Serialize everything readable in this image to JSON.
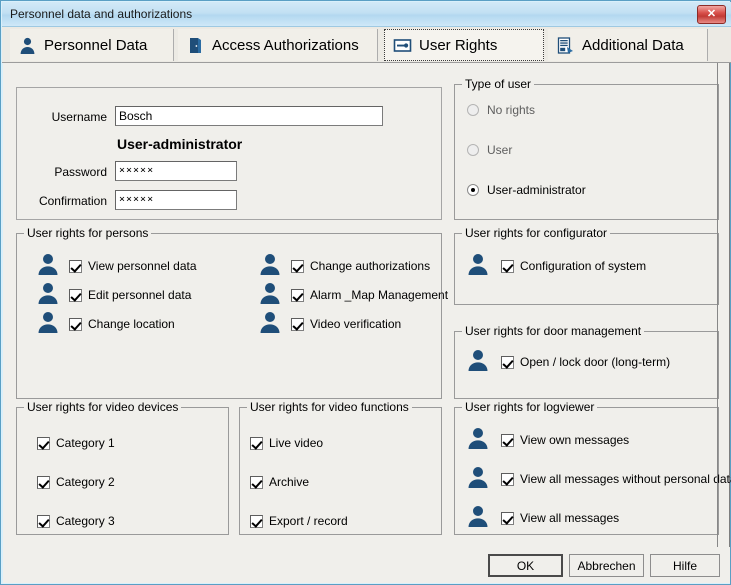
{
  "window": {
    "title": "Personnel data and authorizations",
    "close_label": "✕"
  },
  "tabs": [
    {
      "label": "Personnel Data",
      "icon": "person-icon",
      "active": false
    },
    {
      "label": "Access Authorizations",
      "icon": "door-icon",
      "active": false
    },
    {
      "label": "User Rights",
      "icon": "key-icon",
      "active": true
    },
    {
      "label": "Additional Data",
      "icon": "document-icon",
      "active": false
    }
  ],
  "credentials": {
    "username_label": "Username",
    "username_value": "Bosch",
    "role_heading": "User-administrator",
    "password_label": "Password",
    "password_value": "×××××",
    "confirmation_label": "Confirmation",
    "confirmation_value": "×××××"
  },
  "type_of_user": {
    "title": "Type of user",
    "options": [
      {
        "label": "No rights",
        "selected": false,
        "disabled": true
      },
      {
        "label": "User",
        "selected": false,
        "disabled": true
      },
      {
        "label": "User-administrator",
        "selected": true,
        "disabled": false
      }
    ]
  },
  "rights_persons": {
    "title": "User rights for persons",
    "left": [
      {
        "label": "View personnel data",
        "checked": true
      },
      {
        "label": "Edit personnel data",
        "checked": true
      },
      {
        "label": "Change location",
        "checked": true
      }
    ],
    "right": [
      {
        "label": "Change authorizations",
        "checked": true
      },
      {
        "label": "Alarm _Map Management",
        "checked": true
      },
      {
        "label": "Video verification",
        "checked": true
      }
    ]
  },
  "rights_configurator": {
    "title": "User rights for configurator",
    "items": [
      {
        "label": "Configuration of system",
        "checked": true
      }
    ]
  },
  "rights_door": {
    "title": "User rights for door management",
    "items": [
      {
        "label": "Open / lock door (long-term)",
        "checked": true
      }
    ]
  },
  "rights_video_devices": {
    "title": "User rights for video devices",
    "items": [
      {
        "label": "Category 1",
        "checked": true
      },
      {
        "label": "Category 2",
        "checked": true
      },
      {
        "label": "Category 3",
        "checked": true
      }
    ]
  },
  "rights_video_functions": {
    "title": "User rights for video functions",
    "items": [
      {
        "label": "Live video",
        "checked": true
      },
      {
        "label": "Archive",
        "checked": true
      },
      {
        "label": "Export / record",
        "checked": true
      }
    ]
  },
  "rights_logviewer": {
    "title": "User rights for logviewer",
    "items": [
      {
        "label": "View own messages",
        "checked": true
      },
      {
        "label": "View all messages without personal data",
        "checked": true
      },
      {
        "label": "View all messages",
        "checked": true
      }
    ]
  },
  "buttons": {
    "ok": "OK",
    "cancel": "Abbrechen",
    "help": "Hilfe"
  },
  "colors": {
    "titlebar": "#c2e0f3",
    "close_red": "#d9514c",
    "icon_blue": "#1f4e79",
    "client_bg": "#f0efeb"
  }
}
